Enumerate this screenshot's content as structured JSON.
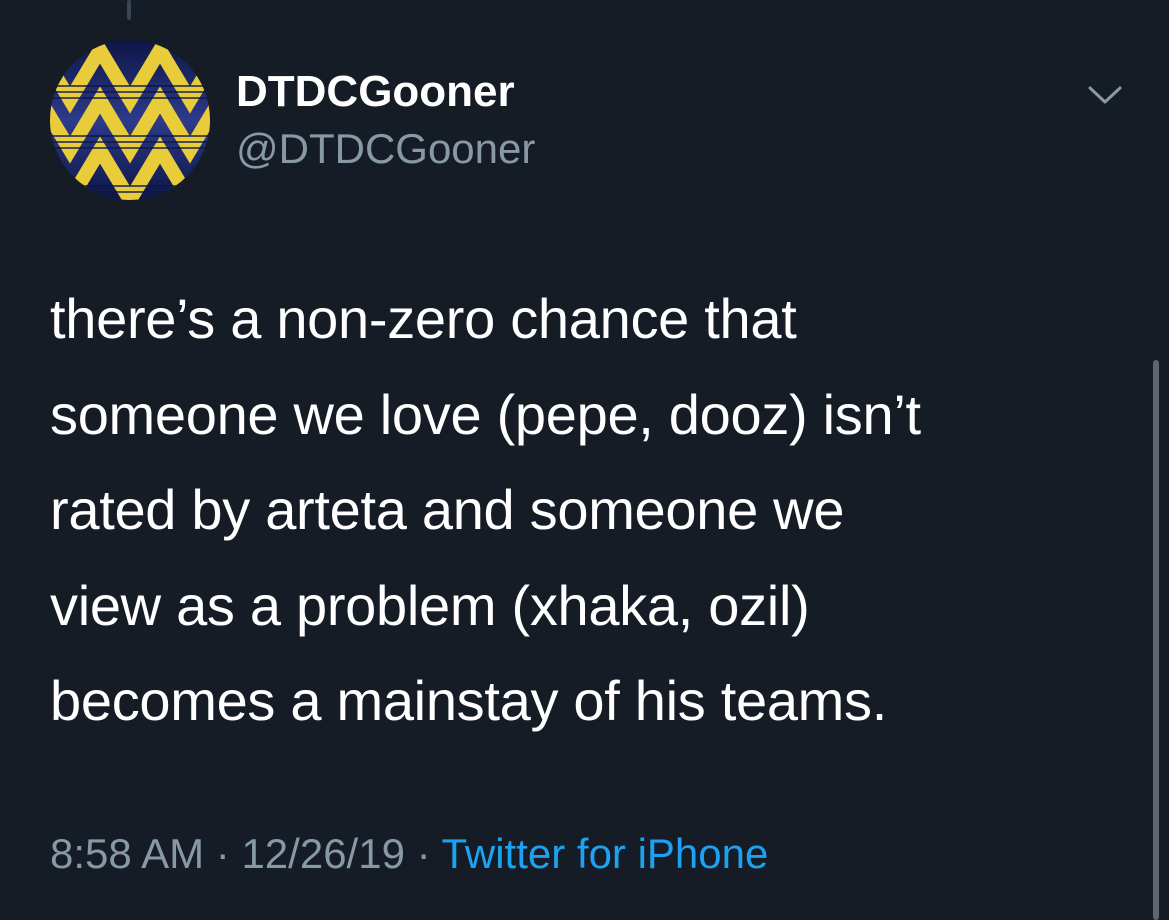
{
  "user": {
    "display_name": "DTDCGooner",
    "handle": "@DTDCGooner"
  },
  "tweet": {
    "lines": [
      "there’s a non-zero chance that",
      "someone we love (pepe, dooz) isn’t",
      "rated by arteta and someone we",
      "view as a problem (xhaka, ozil)",
      "becomes a mainstay of his teams."
    ]
  },
  "meta": {
    "time": "8:58 AM",
    "separator": "·",
    "date": "12/26/19",
    "source": "Twitter for iPhone"
  },
  "icons": {
    "avatar": "arsenal-bruised-banana-pattern-avatar",
    "more": "chevron-down-icon"
  },
  "colors": {
    "background": "#151c26",
    "text_primary": "#ffffff",
    "text_secondary": "#8899a6",
    "link": "#1da1f2",
    "avatar_yellow": "#e8cc3a",
    "avatar_navy": "#1d2a63"
  }
}
